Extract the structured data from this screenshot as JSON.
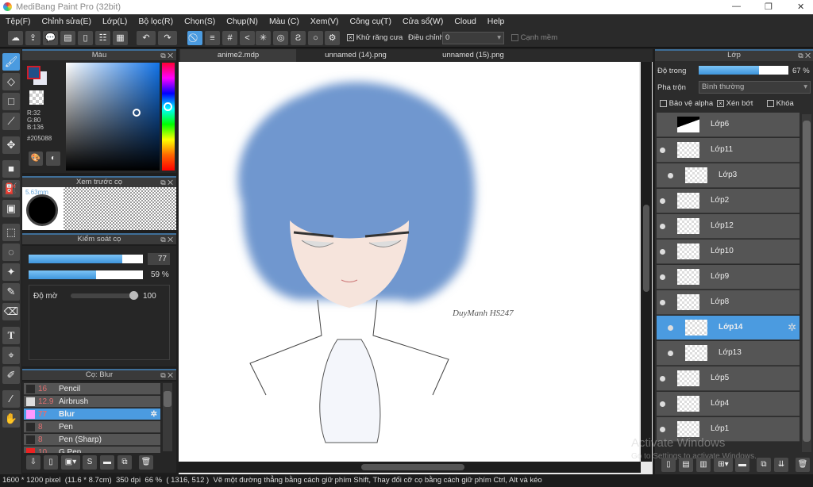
{
  "window": {
    "title": "MediBang Paint Pro (32bit)"
  },
  "menu": [
    "Tệp(F)",
    "Chỉnh sửa(E)",
    "Lớp(L)",
    "Bộ lọc(R)",
    "Chọn(S)",
    "Chụp(N)",
    "Màu (C)",
    "Xem(V)",
    "Công cụ(T)",
    "Cửa sổ(W)",
    "Cloud",
    "Help"
  ],
  "toolbar": {
    "antialias_label": "Khử răng cưa",
    "antialias_checked": true,
    "adjust_label": "Điều chỉnh",
    "adjust_value": "0",
    "soft_edge_label": "Cạnh mềm",
    "soft_edge_checked": false
  },
  "color_panel": {
    "title": "Màu",
    "r": "R:32",
    "g": "G:80",
    "b": "B:136",
    "hex": "#205088",
    "primary_color": "#205088",
    "secondary_color": "#e6e8f2"
  },
  "brush_preview": {
    "title": "Xem trước cọ",
    "size_label": "5.63mm"
  },
  "brush_control": {
    "title": "Kiểm soát cọ",
    "size_value": "77",
    "size_fraction": 0.82,
    "opacity_value": "59 %",
    "opacity_fraction": 0.59,
    "blur_label": "Độ mờ",
    "blur_value": "100"
  },
  "brush_list": {
    "title": "Cọ: Blur",
    "items": [
      {
        "size": "16",
        "name": "Pencil",
        "color": "#2a2a2a"
      },
      {
        "size": "12.9",
        "name": "Airbrush",
        "color": "#dddddd"
      },
      {
        "size": "77",
        "name": "Blur",
        "color": "#ff99ff",
        "selected": true
      },
      {
        "size": "8",
        "name": "Pen",
        "color": "#2a2a2a"
      },
      {
        "size": "8",
        "name": "Pen (Sharp)",
        "color": "#2a2a2a"
      },
      {
        "size": "10",
        "name": "G Pen",
        "color": "#ee2222"
      }
    ]
  },
  "tabs": [
    {
      "label": "anime2.mdp",
      "active": true
    },
    {
      "label": "unnamed (14).png"
    },
    {
      "label": "unnamed (15).png"
    }
  ],
  "canvas": {
    "signature": "DuyManh HS247"
  },
  "layers_panel": {
    "title": "Lớp",
    "opacity_label": "Độ trong",
    "opacity_value": "67 %",
    "opacity_fraction": 0.67,
    "blend_label": "Pha trộn",
    "blend_value": "Bình thường",
    "protect_alpha_label": "Bảo vệ alpha",
    "clip_label": "Xén bớt",
    "lock_label": "Khóa",
    "layers": [
      {
        "name": "Lớp6",
        "visible": false
      },
      {
        "name": "Lớp11",
        "visible": true
      },
      {
        "name": "Lớp3",
        "visible": true,
        "clipped": true
      },
      {
        "name": "Lớp2",
        "visible": true
      },
      {
        "name": "Lớp12",
        "visible": true
      },
      {
        "name": "Lớp10",
        "visible": true
      },
      {
        "name": "Lớp9",
        "visible": true
      },
      {
        "name": "Lớp8",
        "visible": true
      },
      {
        "name": "Lớp14",
        "visible": true,
        "clipped": true,
        "selected": true
      },
      {
        "name": "Lớp13",
        "visible": true,
        "clipped": true
      },
      {
        "name": "Lớp5",
        "visible": true
      },
      {
        "name": "Lớp4",
        "visible": true
      },
      {
        "name": "Lớp1",
        "visible": true
      }
    ]
  },
  "watermark": {
    "line1": "Activate Windows",
    "line2": "Go to Settings to activate Windows."
  },
  "status": {
    "size": "1600 * 1200 pixel",
    "physical": "(11.6 * 8.7cm)",
    "dpi": "350 dpi",
    "zoom": "66 %",
    "coords": "( 1316, 512 )",
    "hint": "Vẽ một đường thẳng bằng cách giữ phím Shift, Thay đổi cỡ cọ bằng cách giữ phím Ctrl, Alt và kéo"
  }
}
